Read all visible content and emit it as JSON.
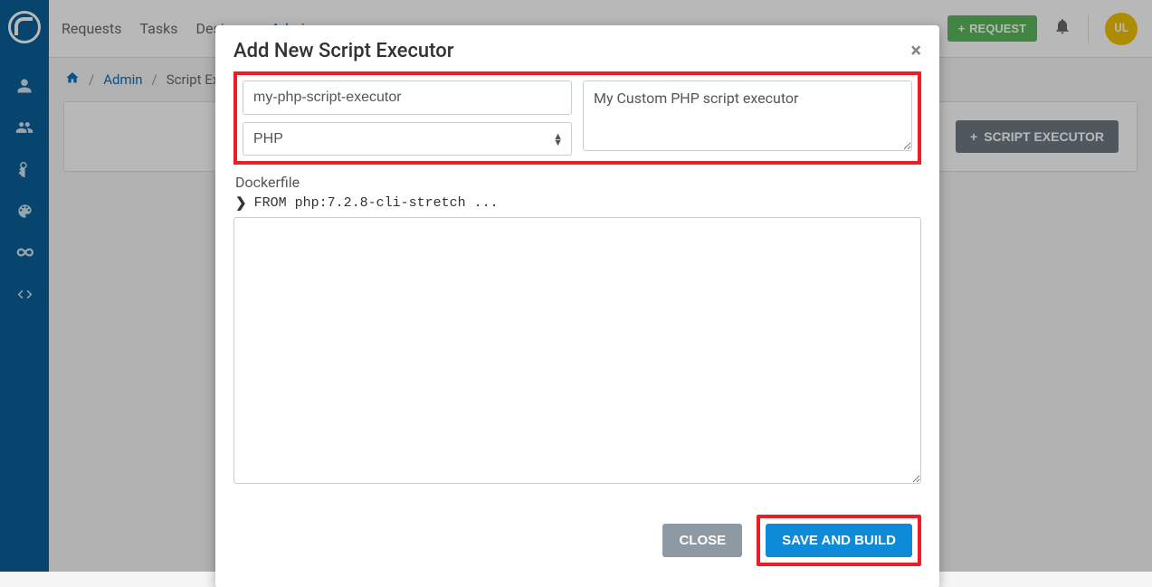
{
  "nav": {
    "links": [
      "Requests",
      "Tasks",
      "Designer",
      "Admin"
    ],
    "request_btn": "REQUEST",
    "avatar_initials": "UL"
  },
  "breadcrumb": {
    "admin": "Admin",
    "current": "Script Executors"
  },
  "panel": {
    "script_executor_btn": "SCRIPT EXECUTOR"
  },
  "modal": {
    "title": "Add New Script Executor",
    "name_value": "my-php-script-executor",
    "language_value": "PHP",
    "description_value": "My Custom PHP script executor",
    "dockerfile_label": "Dockerfile",
    "dockerfile_preview": "FROM php:7.2.8-cli-stretch ...",
    "close_btn": "CLOSE",
    "save_btn": "SAVE AND BUILD"
  }
}
